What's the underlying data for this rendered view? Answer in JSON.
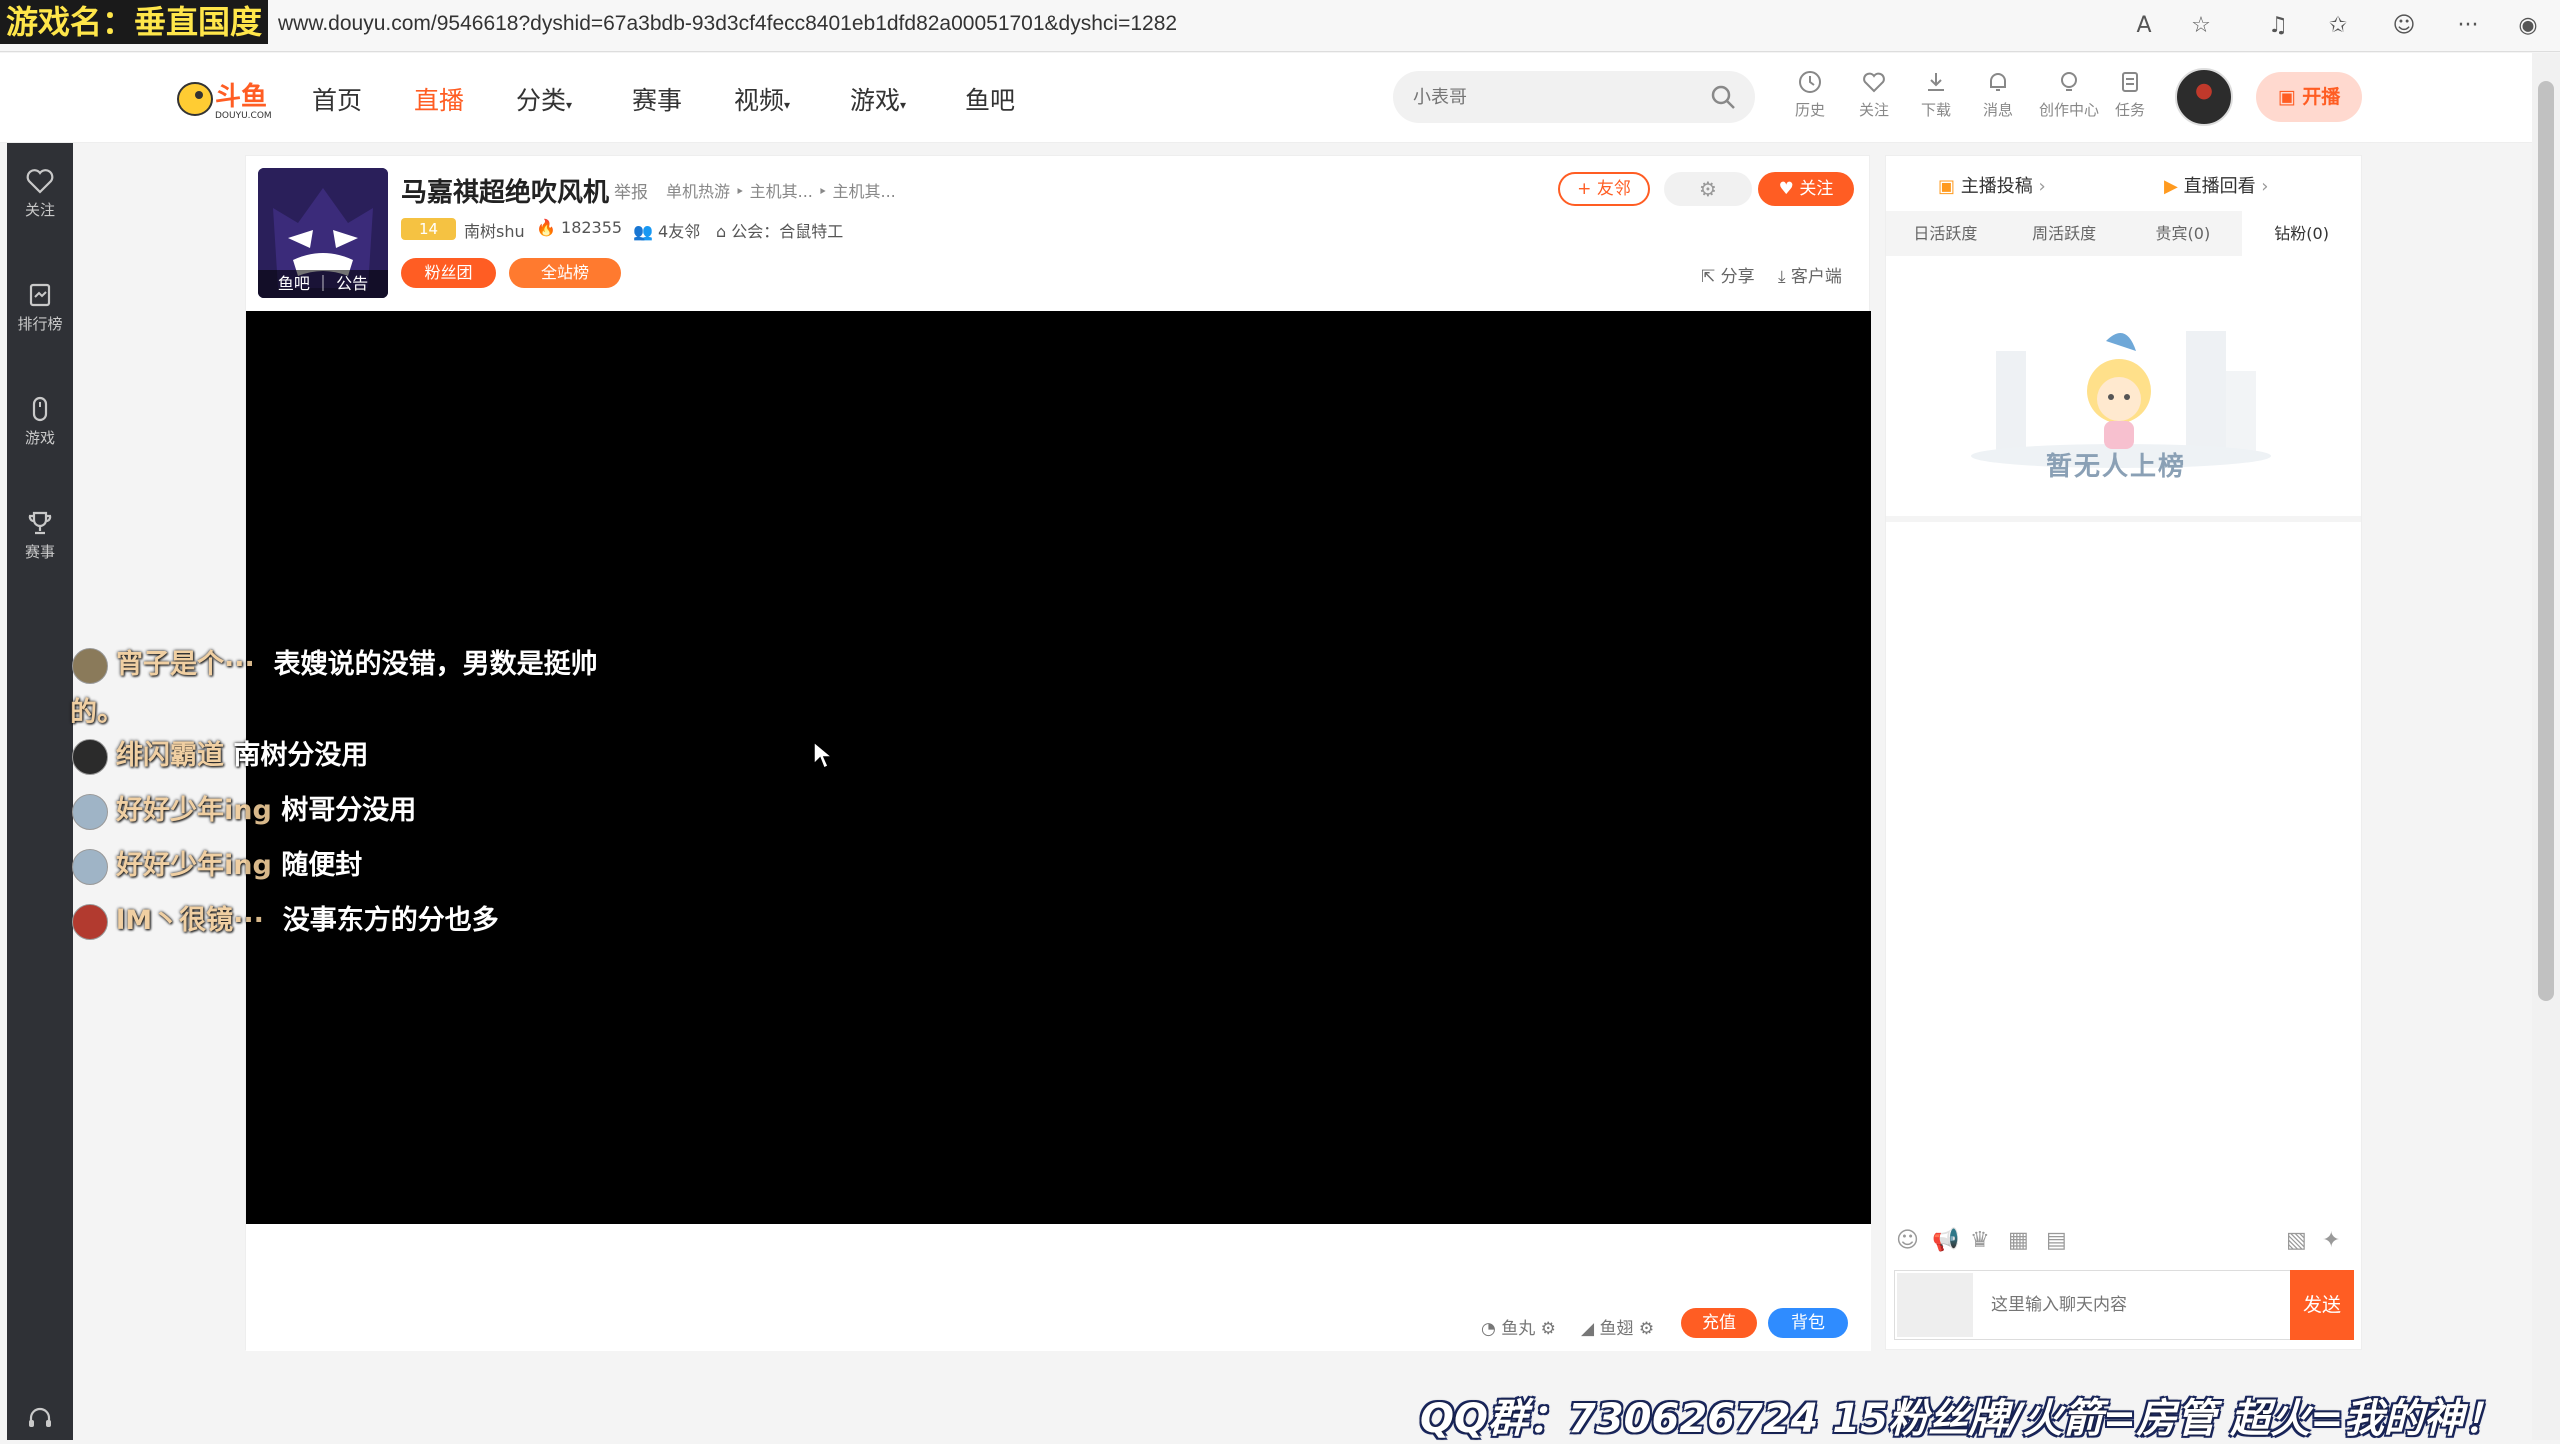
{
  "game_overlay": "游戏名：垂直国度",
  "browser": {
    "url": "www.douyu.com/9546618?dyshid=67a3bdb-93d3cf4fecc8401eb1dfd82a00051701&dyshci=1282"
  },
  "nav": {
    "logo_text": "斗鱼",
    "logo_sub": "DOUYU.COM",
    "items": [
      "首页",
      "直播",
      "分类",
      "赛事",
      "视频",
      "游戏",
      "鱼吧"
    ],
    "search_placeholder": "小表哥",
    "icons": [
      {
        "icon": "history-icon",
        "label": "历史"
      },
      {
        "icon": "follow-icon",
        "label": "关注"
      },
      {
        "icon": "download-icon",
        "label": "下载"
      },
      {
        "icon": "message-icon",
        "label": "消息"
      },
      {
        "icon": "creator-icon",
        "label": "创作中心"
      },
      {
        "icon": "task-icon",
        "label": "任务"
      }
    ],
    "go_live": "开播"
  },
  "sidebar": {
    "items": [
      {
        "icon": "heart-icon",
        "label": "关注"
      },
      {
        "icon": "ranking-icon",
        "label": "排行榜"
      },
      {
        "icon": "game-icon",
        "label": "游戏"
      },
      {
        "icon": "trophy-icon",
        "label": "赛事"
      }
    ]
  },
  "room": {
    "title": "马嘉祺超绝吹风机",
    "report": "举报",
    "breadcrumb": "单机热游 ‣ 主机其... ‣ 主机其...",
    "avatar_strip": "鱼吧 ｜ 公告",
    "level": "14",
    "streamer": "南树shu",
    "heat": "182355",
    "friends": "4友邻",
    "guild": "公会：合鼠特工",
    "fan_club": "粉丝团",
    "site_rank": "全站榜",
    "friend_btn": "+ 友邻",
    "follow_btn": "关注",
    "share": "分享",
    "client": "客户端"
  },
  "danmaku": [
    {
      "name": "宵子是个···",
      "text": "表嫂说的没错，男数是挺帅"
    },
    {
      "name": "",
      "text": "的。"
    },
    {
      "name": "绯闪霸道",
      "text": "南树分没用"
    },
    {
      "name": "好好少年ing",
      "text": "树哥分没用"
    },
    {
      "name": "好好少年ing",
      "text": "随便封"
    },
    {
      "name": "lM丶很镜···",
      "text": "没事东方的分也多"
    }
  ],
  "player_footer": {
    "fish_ball": "鱼丸",
    "fish_wing": "鱼翅",
    "recharge": "充值",
    "backpack": "背包"
  },
  "right_panel": {
    "header_a": "主播投稿",
    "header_b": "直播回看",
    "tabs": [
      "日活跃度",
      "周活跃度",
      "贵宾(0)",
      "钻粉(0)"
    ],
    "empty_text": "暂无人上榜",
    "chat_placeholder": "这里输入聊天内容",
    "send": "发送"
  },
  "bottom_overlay": "QQ群：730626724  15粉丝牌/火箭=房管  超火=我的神！",
  "colors": {
    "accent": "#ff5d23",
    "blue": "#2f8cff",
    "sidebar": "#2f3136"
  }
}
